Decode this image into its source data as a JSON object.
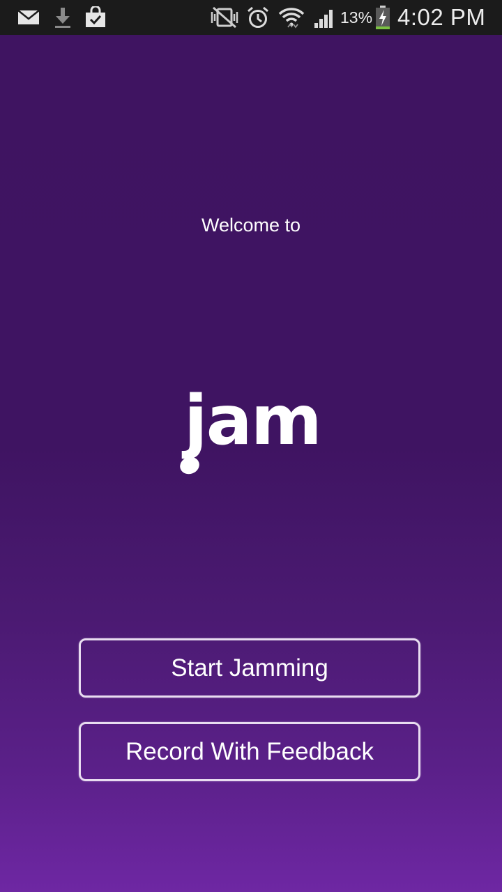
{
  "status_bar": {
    "battery_percent": "13%",
    "time": "4:02 PM",
    "notifications": [
      "mail-icon",
      "download-icon",
      "shopping-bag-check-icon"
    ],
    "system": [
      "no-signal-vibrate-icon",
      "alarm-clock-icon",
      "wifi-icon",
      "cell-signal-icon",
      "battery-charging-icon"
    ],
    "battery_level": 0.13,
    "battery_color": "#7bc142"
  },
  "welcome_text": "Welcome to",
  "logo": {
    "text": "jam",
    "icon": "music-note-icon"
  },
  "buttons": {
    "start": "Start Jamming",
    "record": "Record With Feedback"
  },
  "colors": {
    "background_top": "#3f1461",
    "background_bottom": "#6e27a3",
    "button_border": "#e8dcf0",
    "text": "#ffffff"
  }
}
